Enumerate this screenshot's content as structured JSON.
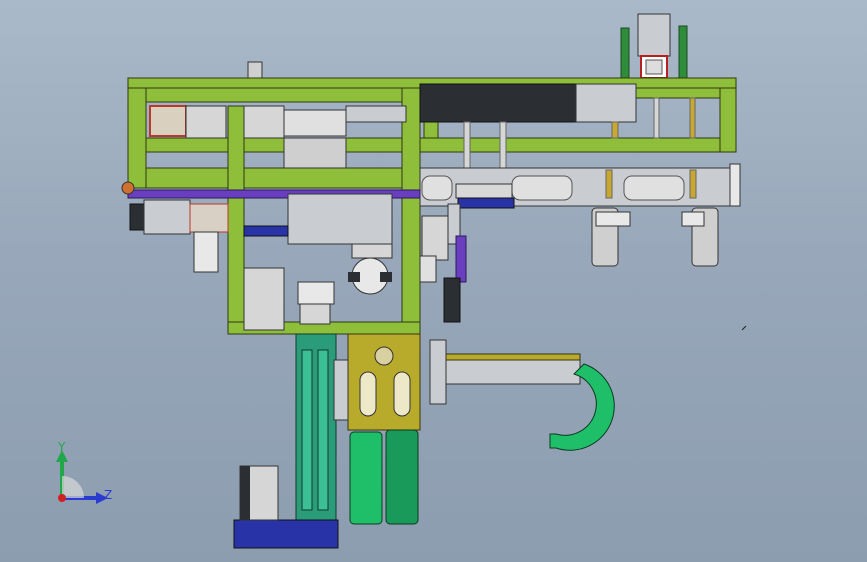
{
  "viewport": {
    "background_top": "#aab9c9",
    "background_bottom": "#8d9db0"
  },
  "triad": {
    "y_label": "Y",
    "z_label": "Z",
    "y_color": "#22a64a",
    "z_color": "#2a3bd0",
    "origin_color": "#d02020"
  },
  "parts": {
    "frame_color": "#8fbf3a",
    "frame_edge": "#2d3a12",
    "steel_color": "#c9ccd0",
    "dark_color": "#2b2f33",
    "purple_color": "#6a3fbf",
    "blue_color": "#2933a8",
    "olive_color": "#b8aa2a",
    "green_wheel_color": "#1fbf6a",
    "teal_column_color": "#2a9c7a",
    "red_color": "#b83a2a"
  }
}
